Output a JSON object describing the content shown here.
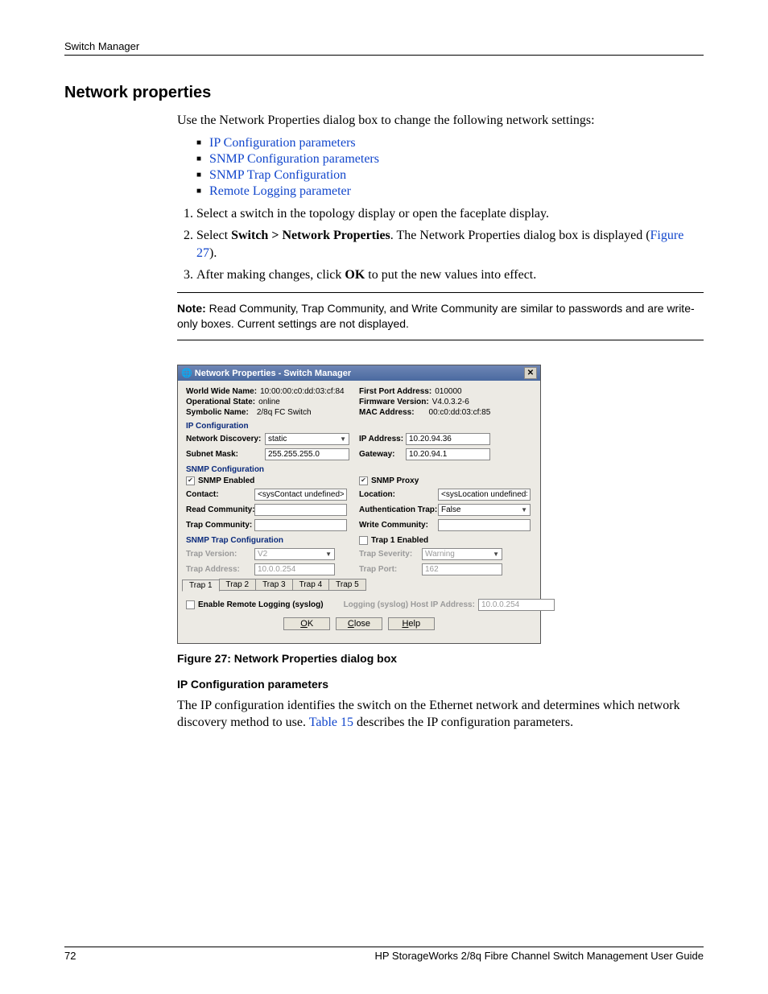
{
  "header": {
    "section": "Switch Manager"
  },
  "heading": "Network properties",
  "intro": "Use the Network Properties dialog box to change the following network settings:",
  "bullets": [
    "IP Configuration parameters",
    "SNMP Configuration parameters",
    "SNMP Trap Configuration",
    "Remote Logging parameter"
  ],
  "steps": {
    "s1": "Select a switch in the topology display or open the faceplate display.",
    "s2a": "Select ",
    "s2b": "Switch > Network Properties",
    "s2c": ". The Network Properties dialog box is displayed (",
    "s2d": "Figure 27",
    "s2e": ").",
    "s3a": "After making changes, click ",
    "s3b": "OK",
    "s3c": " to put the new values into effect."
  },
  "note": {
    "label": "Note:",
    "text": " Read Community, Trap Community, and Write Community are similar to passwords and are write-only boxes. Current settings are not displayed."
  },
  "dialog": {
    "title": "Network Properties - Switch Manager",
    "info": {
      "wwn_label": "World Wide Name:",
      "wwn": "10:00:00:c0:dd:03:cf:84",
      "opstate_label": "Operational State:",
      "opstate": "online",
      "symname_label": "Symbolic Name:",
      "symname": "2/8q FC Switch",
      "fpa_label": "First Port Address:",
      "fpa": "010000",
      "fw_label": "Firmware Version:",
      "fw": "V4.0.3.2-6",
      "mac_label": "MAC Address:",
      "mac": "00:c0:dd:03:cf:85"
    },
    "ip": {
      "section": "IP Configuration",
      "nd_label": "Network Discovery:",
      "nd": "static",
      "ip_label": "IP Address:",
      "ip": "10.20.94.36",
      "sm_label": "Subnet Mask:",
      "sm": "255.255.255.0",
      "gw_label": "Gateway:",
      "gw": "10.20.94.1"
    },
    "snmp": {
      "section": "SNMP Configuration",
      "enabled_label": "SNMP Enabled",
      "proxy_label": "SNMP Proxy",
      "contact_label": "Contact:",
      "contact": "<sysContact undefined>",
      "location_label": "Location:",
      "location": "<sysLocation undefined>",
      "readcomm_label": "Read Community:",
      "authtrap_label": "Authentication Trap:",
      "authtrap": "False",
      "trapcomm_label": "Trap Community:",
      "writecomm_label": "Write Community:"
    },
    "trap": {
      "section": "SNMP Trap Configuration",
      "trap1_enabled_label": "Trap 1 Enabled",
      "ver_label": "Trap Version:",
      "ver": "V2",
      "sev_label": "Trap Severity:",
      "sev": "Warning",
      "addr_label": "Trap Address:",
      "addr": "10.0.0.254",
      "port_label": "Trap Port:",
      "port": "162",
      "tabs": [
        "Trap 1",
        "Trap 2",
        "Trap 3",
        "Trap 4",
        "Trap 5"
      ]
    },
    "remote": {
      "enable_label": "Enable Remote Logging (syslog)",
      "host_label": "Logging (syslog) Host IP Address:",
      "host": "10.0.0.254"
    },
    "buttons": {
      "ok": "OK",
      "close": "Close",
      "help": "Help"
    }
  },
  "figure_caption": "Figure 27:  Network Properties dialog box",
  "subheading": "IP Configuration parameters",
  "subparagraph_a": "The IP configuration identifies the switch on the Ethernet network and determines which network discovery method to use. ",
  "subparagraph_link": "Table 15",
  "subparagraph_b": " describes the IP configuration parameters.",
  "footer": {
    "page": "72",
    "title": "HP StorageWorks 2/8q Fibre Channel Switch Management User Guide"
  }
}
